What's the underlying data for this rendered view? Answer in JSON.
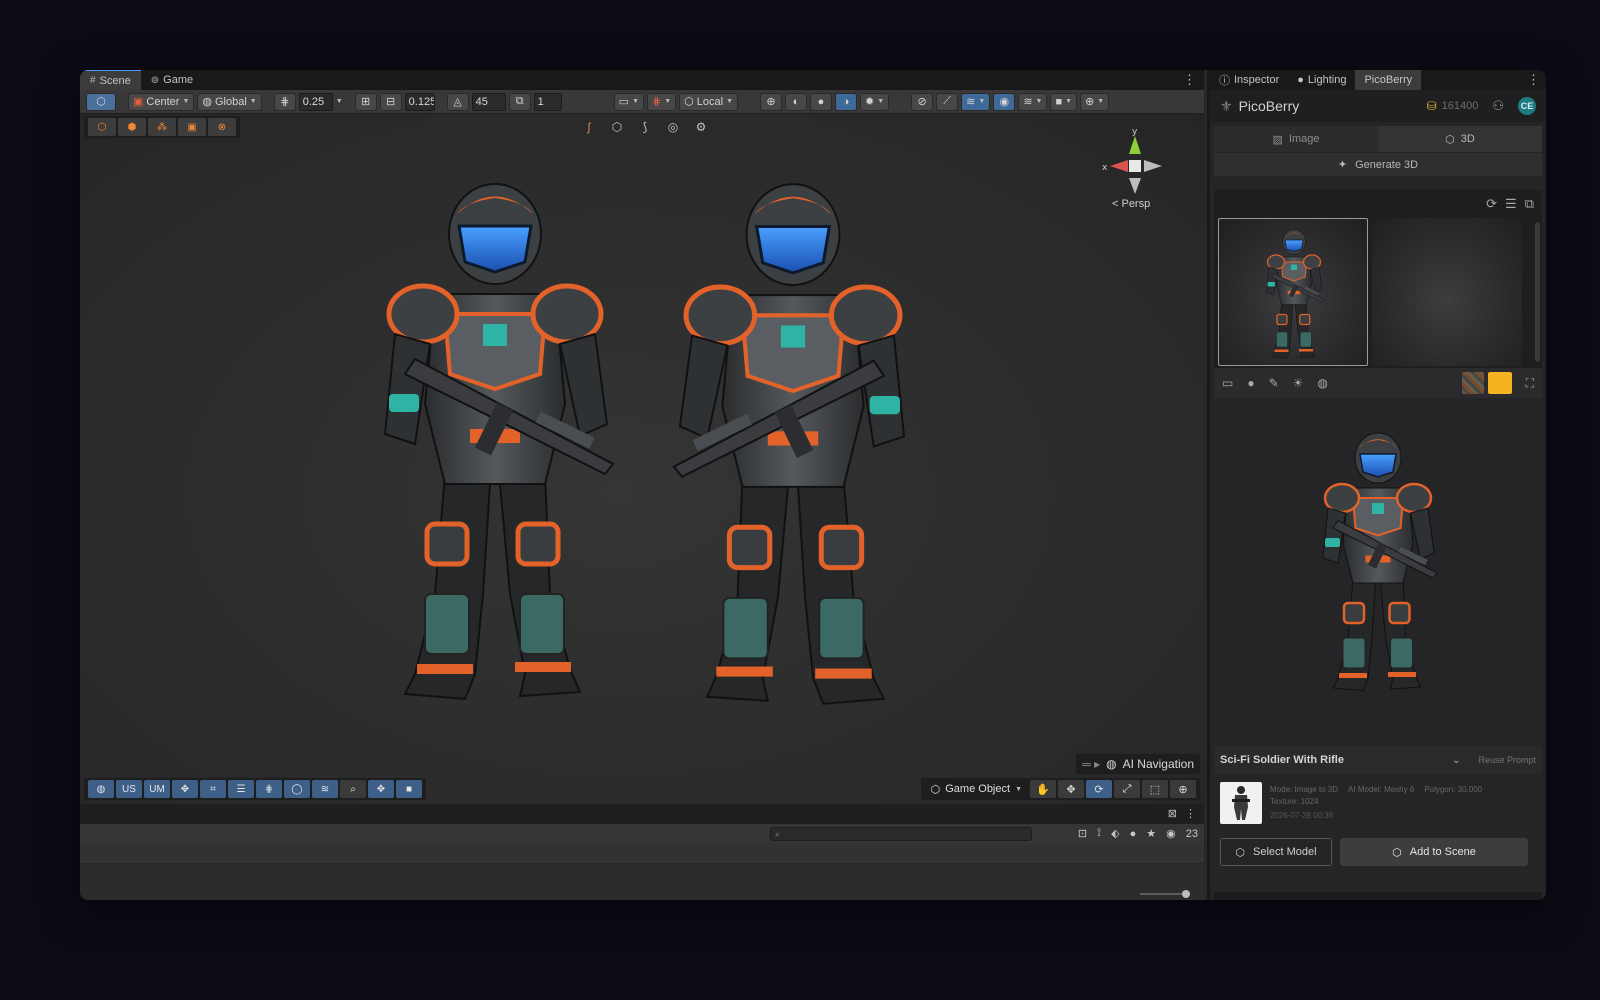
{
  "scene_window": {
    "tabs": [
      {
        "label": "Scene",
        "icon": "grid-icon"
      },
      {
        "label": "Game",
        "icon": "gamepad-icon"
      }
    ]
  },
  "toolbar": {
    "pivot": "Center",
    "space": "Global",
    "grid_snap": "0.25",
    "rotate_snap": "0.125",
    "angle_snap": "45",
    "scale_snap": "1",
    "transform_space": "Local"
  },
  "scene_view": {
    "gizmo": {
      "y_label": "y",
      "x_label": "x"
    },
    "projection": "< Persp",
    "ai_navigation": "AI Navigation",
    "bottom_tools": [
      "US",
      "UM"
    ],
    "game_object_select": "Game Object"
  },
  "console": {
    "search_placeholder": "",
    "count": "23"
  },
  "right_panel": {
    "tabs": [
      {
        "label": "Inspector",
        "icon": "info-icon"
      },
      {
        "label": "Lighting",
        "icon": "bulb-icon"
      },
      {
        "label": "PicoBerry",
        "icon": ""
      }
    ]
  },
  "picoberry": {
    "title": "PicoBerry",
    "credits": "161400",
    "avatar_initials": "CE",
    "mode_tabs": [
      {
        "label": "Image",
        "icon": "image-icon"
      },
      {
        "label": "3D",
        "icon": "cube-icon"
      }
    ],
    "generate_label": "Generate 3D",
    "detail": {
      "title": "Sci-Fi Soldier With Rifle",
      "reuse_label": "Reuse Prompt",
      "mode": "Mode: Image to 3D",
      "ai_model": "AI Model: Meshy 6",
      "polygon": "Polygon: 30,000",
      "texture": "Texture: 1024",
      "date": "2026-07-28 00:38"
    },
    "select_model_label": "Select Model",
    "add_to_scene_label": "Add to Scene"
  },
  "colors": {
    "accent_blue": "#3d5f88",
    "orange_trim": "#e2622a",
    "visor_blue": "#2f7fe0",
    "teal": "#2fb3a4"
  }
}
